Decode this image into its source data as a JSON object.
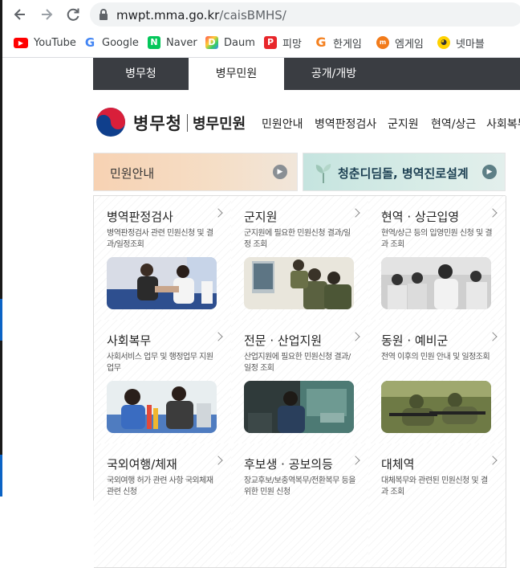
{
  "browser": {
    "url_host": "mwpt.mma.go.kr",
    "url_path": "/caisBMHS/",
    "bookmarks": [
      {
        "label": "YouTube",
        "icon": "youtube-icon",
        "color": "#ff0000"
      },
      {
        "label": "Google",
        "icon": "google-icon",
        "color": "#4285f4"
      },
      {
        "label": "Naver",
        "icon": "naver-icon",
        "color": "#03c75a"
      },
      {
        "label": "Daum",
        "icon": "daum-icon",
        "color": "#8a5cf6"
      },
      {
        "label": "피망",
        "icon": "pmang-icon",
        "color": "#e8262a"
      },
      {
        "label": "한게임",
        "icon": "hangame-icon",
        "color": "#f4801f"
      },
      {
        "label": "엠게임",
        "icon": "mgame-icon",
        "color": "#f27b1a"
      },
      {
        "label": "넷마블",
        "icon": "netmarble-icon",
        "color": "#ffd200"
      }
    ]
  },
  "site_nav": {
    "tabs": [
      {
        "label": "병무청",
        "active": false
      },
      {
        "label": "병무민원",
        "active": true
      },
      {
        "label": "공개/개방",
        "active": false
      }
    ]
  },
  "header": {
    "logo_text": "병무청",
    "logo_sub": "병무민원",
    "menu": [
      "민원안내",
      "병역판정검사",
      "군지원",
      "현역/상근",
      "사회복무"
    ]
  },
  "banners": [
    {
      "label": "민원안내"
    },
    {
      "label": "청춘디딤돌, 병역진로설계"
    }
  ],
  "services": [
    {
      "title": "병역판정검사",
      "desc": "병역판정검사 관련 민원신청 및 결과/일정조회"
    },
    {
      "title": "군지원",
      "desc": "군지원에 필요한 민원신청 결과/일정 조회"
    },
    {
      "title": "현역 · 상근입영",
      "desc": "현역/상근 등의 입영민원 신청 및 결과 조회"
    },
    {
      "title": "사회복무",
      "desc": "사회서비스 업무 및 행정업무 지원 업무"
    },
    {
      "title": "전문 · 산업지원",
      "desc": "산업지원에 필요한 민원신청 결과/일정 조회"
    },
    {
      "title": "동원 · 예비군",
      "desc": "전역 이후의 민원 안내 및 일정조회"
    },
    {
      "title": "국외여행/체재",
      "desc": "국외여행 허가 관련 사항 국외체재 관련 신청"
    },
    {
      "title": "후보생 · 공보의등",
      "desc": "장교후보/보충역복무/전환복무 등을 위한 민원 신청"
    },
    {
      "title": "대체역",
      "desc": "대체복무와 관련된 민원신청 및 결과 조회"
    }
  ]
}
